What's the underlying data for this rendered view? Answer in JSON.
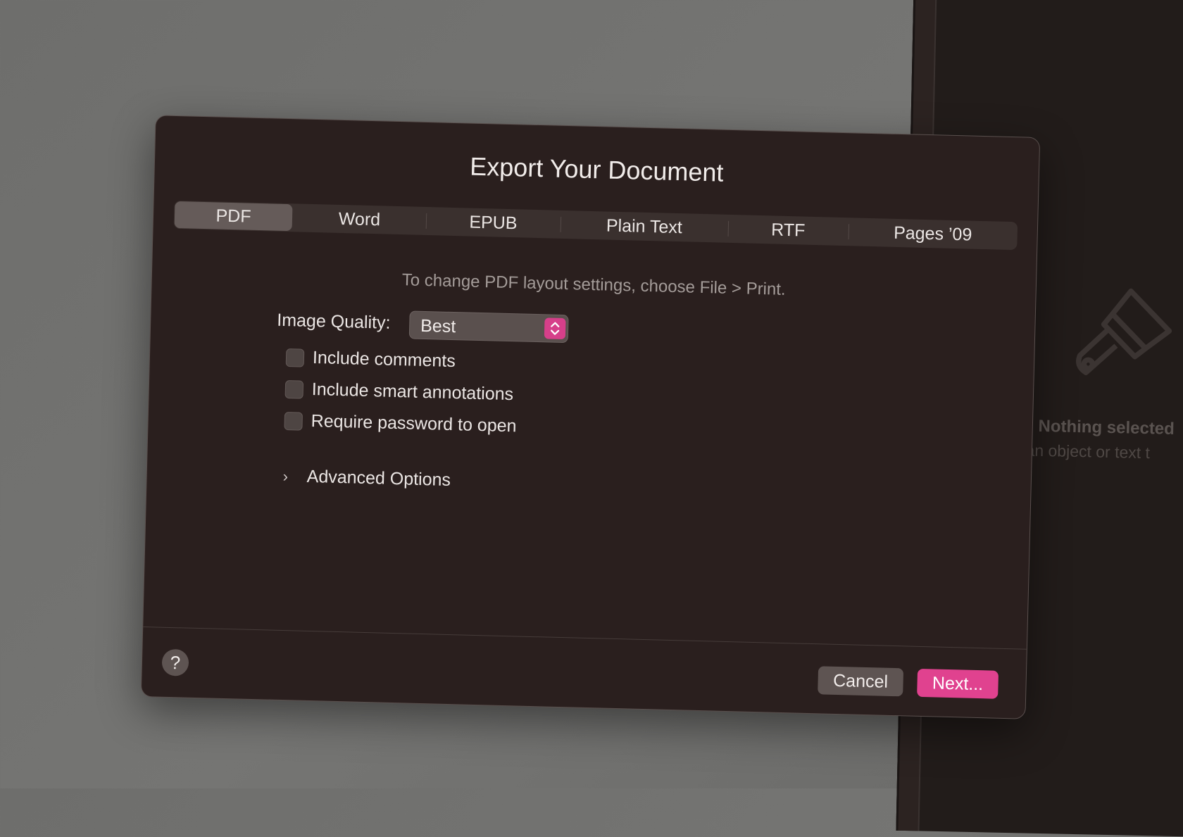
{
  "background": {
    "inspector": {
      "title": "Nothing selected",
      "hint": "t an object or text t",
      "icon": "paintbrush-icon"
    }
  },
  "dialog": {
    "title": "Export Your Document",
    "tabs": [
      {
        "label": "PDF",
        "selected": true
      },
      {
        "label": "Word",
        "selected": false
      },
      {
        "label": "EPUB",
        "selected": false
      },
      {
        "label": "Plain Text",
        "selected": false
      },
      {
        "label": "RTF",
        "selected": false
      },
      {
        "label": "Pages ’09",
        "selected": false
      }
    ],
    "subtitle": "To change PDF layout settings, choose File > Print.",
    "image_quality": {
      "label": "Image Quality:",
      "value": "Best"
    },
    "checkboxes": [
      {
        "label": "Include comments",
        "checked": false
      },
      {
        "label": "Include smart annotations",
        "checked": false
      },
      {
        "label": "Require password to open",
        "checked": false
      }
    ],
    "advanced_options": "Advanced Options",
    "help": "?",
    "cancel": "Cancel",
    "next": "Next..."
  },
  "colors": {
    "accent": "#e0428f",
    "dialog_bg": "#2a1f1e"
  }
}
